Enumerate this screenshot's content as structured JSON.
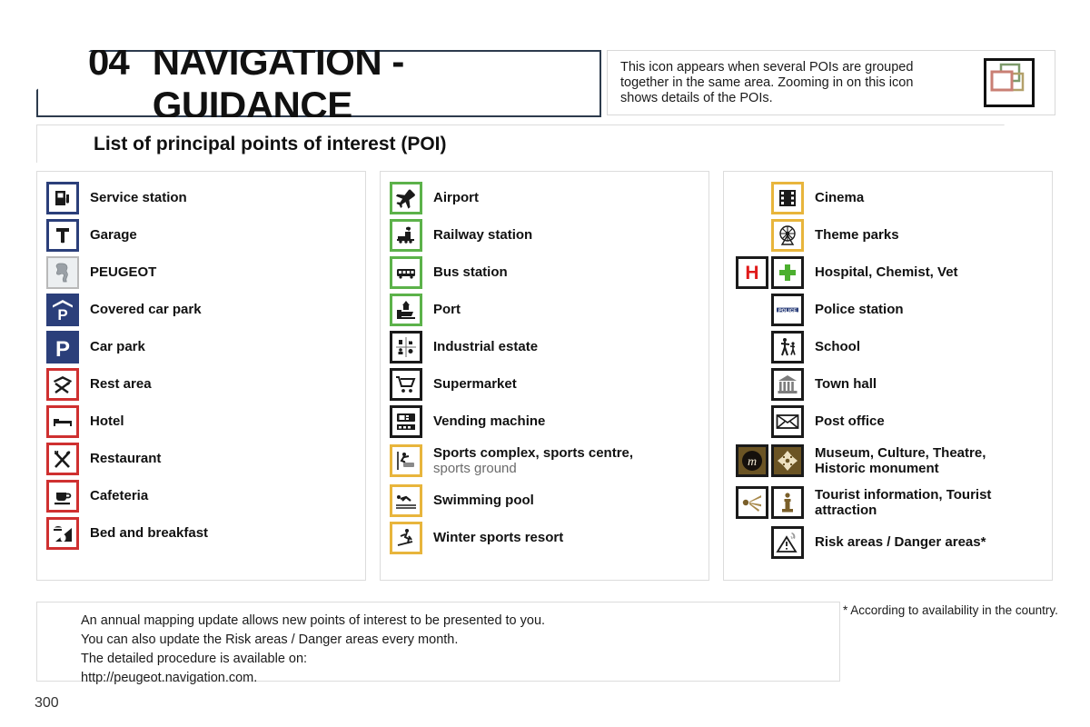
{
  "header": {
    "chapter_number": "04",
    "chapter_title": "NAVIGATION - GUIDANCE",
    "info_text": "This icon appears when several POIs are grouped together in the same area. Zooming in on this icon shows details of the POIs.",
    "info_icon_name": "grouped-pois-icon"
  },
  "banner": {
    "title": "List of principal points of interest (POI)"
  },
  "columns": [
    {
      "id": "column-1",
      "items": [
        {
          "label": "Service station",
          "icon": "fuel-pump-icon",
          "style": "navy"
        },
        {
          "label": "Garage",
          "icon": "wrench-icon",
          "style": "navy"
        },
        {
          "label": "PEUGEOT",
          "icon": "peugeot-lion-icon",
          "style": "grey"
        },
        {
          "label": "Covered car park",
          "icon": "covered-parking-icon",
          "style": "navy-fill"
        },
        {
          "label": "Car park",
          "icon": "parking-icon",
          "style": "navy-fill"
        },
        {
          "label": "Rest area",
          "icon": "rest-area-icon",
          "style": "red"
        },
        {
          "label": "Hotel",
          "icon": "bed-icon",
          "style": "red"
        },
        {
          "label": "Restaurant",
          "icon": "cutlery-icon",
          "style": "red"
        },
        {
          "label": "Cafeteria",
          "icon": "coffee-cup-icon",
          "style": "red"
        },
        {
          "label": "Bed and breakfast",
          "icon": "bed-breakfast-icon",
          "style": "red"
        }
      ]
    },
    {
      "id": "column-2",
      "items": [
        {
          "label": "Airport",
          "icon": "airplane-icon",
          "style": "green"
        },
        {
          "label": "Railway station",
          "icon": "train-icon",
          "style": "green"
        },
        {
          "label": "Bus station",
          "icon": "bus-icon",
          "style": "green"
        },
        {
          "label": "Port",
          "icon": "port-ship-icon",
          "style": "green"
        },
        {
          "label": "Industrial estate",
          "icon": "industrial-estate-icon",
          "style": "black"
        },
        {
          "label": "Supermarket",
          "icon": "shopping-cart-icon",
          "style": "black"
        },
        {
          "label": "Vending machine",
          "icon": "vending-machine-icon",
          "style": "black"
        },
        {
          "label": "Sports complex, sports centre,",
          "sublabel": "sports ground",
          "icon": "sports-complex-icon",
          "style": "gold"
        },
        {
          "label": "Swimming pool",
          "icon": "swimmer-icon",
          "style": "gold"
        },
        {
          "label": "Winter sports resort",
          "icon": "skier-icon",
          "style": "gold"
        }
      ]
    },
    {
      "id": "column-3",
      "items": [
        {
          "label": "Cinema",
          "icon": "film-reel-icon",
          "style": "gold"
        },
        {
          "label": "Theme parks",
          "icon": "ferris-wheel-icon",
          "style": "gold"
        },
        {
          "label": "Hospital, Chemist, Vet",
          "icon": "hospital-h-icon",
          "icon2": "green-cross-icon",
          "style": "black"
        },
        {
          "label": "Police station",
          "icon": "police-sign-icon",
          "style": "black"
        },
        {
          "label": "School",
          "icon": "school-crossing-icon",
          "style": "black"
        },
        {
          "label": "Town hall",
          "icon": "town-hall-icon",
          "style": "black"
        },
        {
          "label": "Post office",
          "icon": "envelope-icon",
          "style": "black"
        },
        {
          "label": "Museum, Culture, Theatre,",
          "sublabel2": "Historic monument",
          "icon": "museum-m-icon",
          "icon2": "historic-monument-icon",
          "style": "brown"
        },
        {
          "label": "Tourist information, Tourist",
          "sublabel2": "attraction",
          "icon": "tourist-attraction-icon",
          "icon2": "tourist-info-icon",
          "style": "brown-light"
        },
        {
          "label": "Risk areas / Danger areas*",
          "icon": "danger-warning-icon",
          "style": "black"
        }
      ]
    }
  ],
  "footer": {
    "line1": "An annual mapping update allows new points of interest to be presented to you.",
    "line2": "You can also update the Risk areas / Danger areas every month.",
    "line3": "The detailed procedure is available on:",
    "line4": "http://peugeot.navigation.com."
  },
  "footnote": "* According to availability in the country.",
  "page_number": "300",
  "colors": {
    "navy": "#2b3f7a",
    "red": "#cf3030",
    "green": "#5cb24a",
    "gold": "#e8b53c",
    "black": "#1a1a1a",
    "brown": "#6b5424",
    "title_border": "#2d3b4d"
  }
}
